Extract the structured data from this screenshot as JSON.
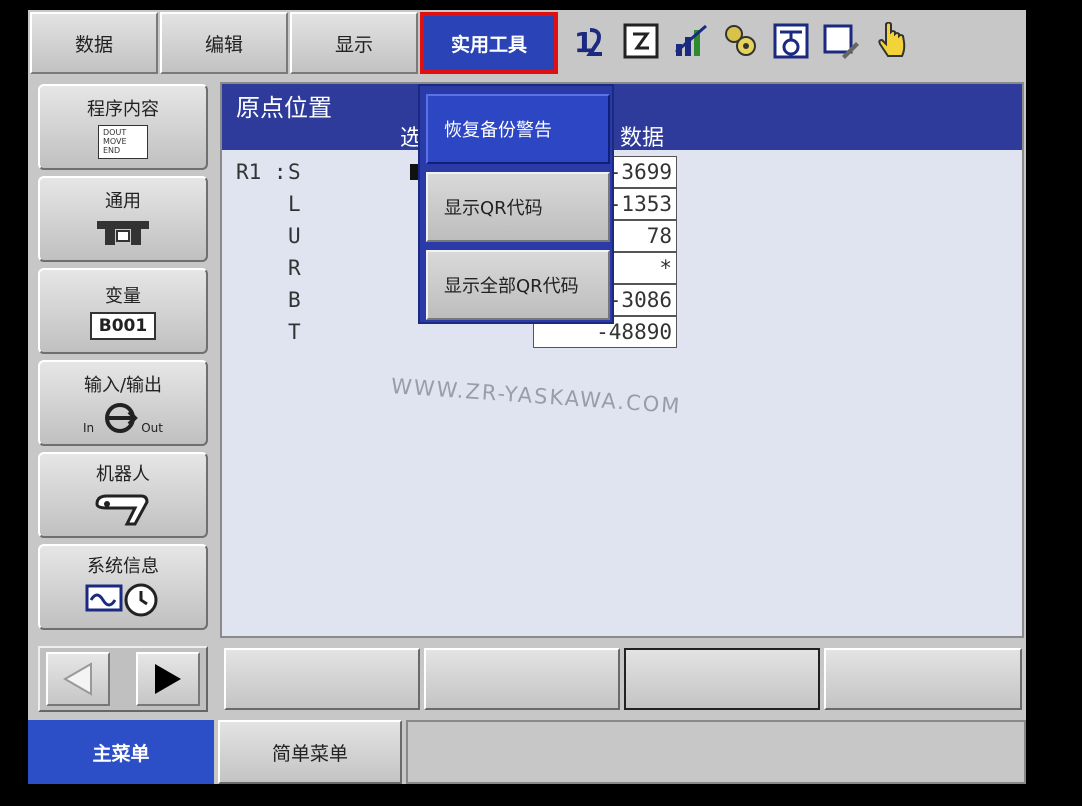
{
  "menubar": {
    "items": [
      {
        "label": "数据"
      },
      {
        "label": "编辑"
      },
      {
        "label": "显示"
      },
      {
        "label": "实用工具"
      }
    ]
  },
  "toolbar": {
    "icons": [
      "axis-switch-icon",
      "checklist-icon",
      "signal-strength-icon",
      "gear-coordinate-icon",
      "tool-icon",
      "monitor-edit-icon",
      "pointing-hand-icon"
    ]
  },
  "sidebar": {
    "items": [
      {
        "label": "程序内容",
        "icon": "program-doc-icon",
        "icon_lines": [
          "DOUT",
          "MOVE",
          "END"
        ]
      },
      {
        "label": "通用",
        "icon": "general-tool-icon"
      },
      {
        "label": "变量",
        "icon": "variable-box-icon",
        "icon_text": "B001"
      },
      {
        "label": "输入/输出",
        "icon": "io-icon",
        "icon_in": "In",
        "icon_out": "Out"
      },
      {
        "label": "机器人",
        "icon": "robot-arm-icon"
      },
      {
        "label": "系统信息",
        "icon": "system-info-icon"
      }
    ]
  },
  "main": {
    "title": "原点位置",
    "col_select_partial": "选",
    "col_data_partial": "数据",
    "robot_prefix": "R1 :",
    "rows": [
      {
        "axis": "S",
        "value": "-3699"
      },
      {
        "axis": "L",
        "value": "-1353"
      },
      {
        "axis": "U",
        "value": "78"
      },
      {
        "axis": "R",
        "value": "*"
      },
      {
        "axis": "B",
        "value": "-3086"
      },
      {
        "axis": "T",
        "value": "-48890"
      }
    ],
    "watermark": "WWW.ZR-YASKAWA.COM"
  },
  "dropdown": {
    "items": [
      {
        "label": "恢复备份警告",
        "selected": true
      },
      {
        "label": "显示QR代码",
        "selected": false
      },
      {
        "label": "显示全部QR代码",
        "selected": false
      }
    ]
  },
  "bottom": {
    "main_menu": "主菜单",
    "simple_menu": "简单菜单"
  },
  "colors": {
    "header_blue": "#2e3b9a",
    "active_blue": "#2a44b8",
    "highlight_red": "#e01010"
  }
}
